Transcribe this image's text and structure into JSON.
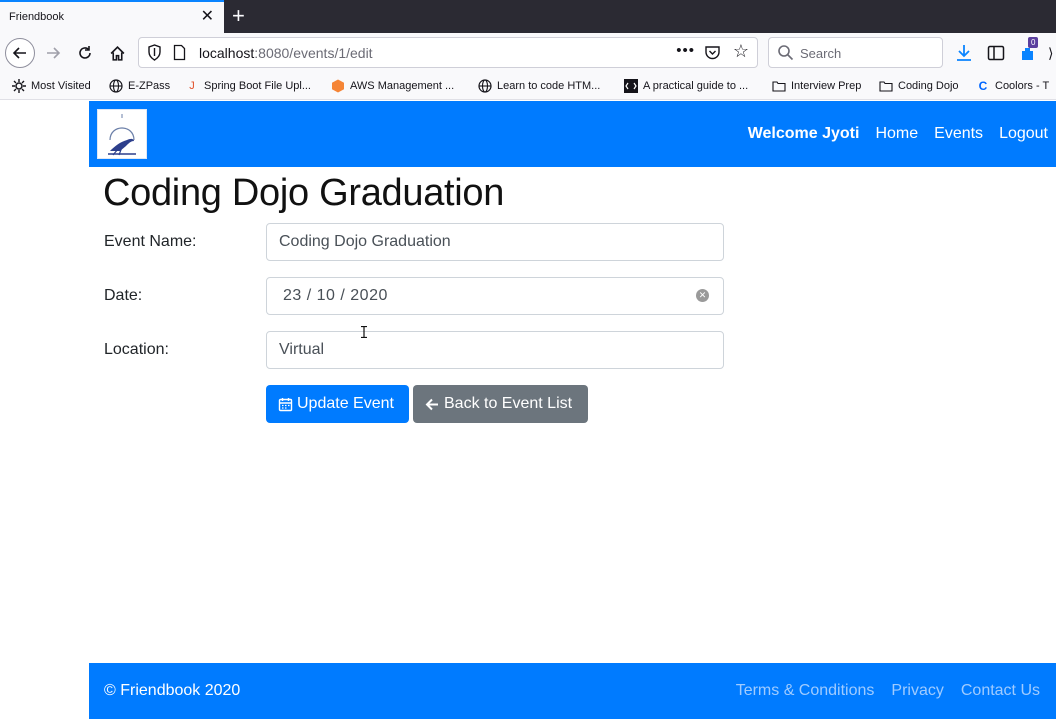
{
  "browser": {
    "tab_title": "Friendbook",
    "tab_close": "✕",
    "new_tab": "+",
    "url_host": "localhost",
    "url_rest": ":8080/events/1/edit",
    "url_dots": "•••",
    "search_placeholder": "Search",
    "extension_badge": "0",
    "bookmarks": [
      {
        "label": "Most Visited",
        "icon": "gear-icon"
      },
      {
        "label": "E-ZPass",
        "icon": "globe-icon"
      },
      {
        "label": "Spring Boot File Upl...",
        "icon": "j-icon"
      },
      {
        "label": "AWS Management ...",
        "icon": "aws-icon"
      },
      {
        "label": "Learn to code HTM...",
        "icon": "globe-icon"
      },
      {
        "label": "A practical guide to ...",
        "icon": "code-icon"
      },
      {
        "label": "Interview Prep",
        "icon": "folder-icon"
      },
      {
        "label": "Coding Dojo",
        "icon": "folder-icon"
      },
      {
        "label": "Coolors - T",
        "icon": "coolors-icon"
      }
    ]
  },
  "app": {
    "nav": {
      "welcome": "Welcome Jyoti",
      "home": "Home",
      "events": "Events",
      "logout": "Logout"
    },
    "title": "Coding Dojo Graduation",
    "form": {
      "event_name_label": "Event Name:",
      "event_name_value": "Coding Dojo Graduation",
      "date_label": "Date:",
      "date_value": "23 / 10 / 2020",
      "location_label": "Location:",
      "location_value": "Virtual"
    },
    "buttons": {
      "update": "Update Event",
      "back": "Back to Event List"
    },
    "footer": {
      "copyright": "© Friendbook 2020",
      "terms": "Terms & Conditions",
      "privacy": "Privacy",
      "contact": "Contact Us"
    }
  },
  "colors": {
    "primary": "#007bff",
    "secondary": "#6c757d",
    "footer_link": "#9fcbff"
  }
}
